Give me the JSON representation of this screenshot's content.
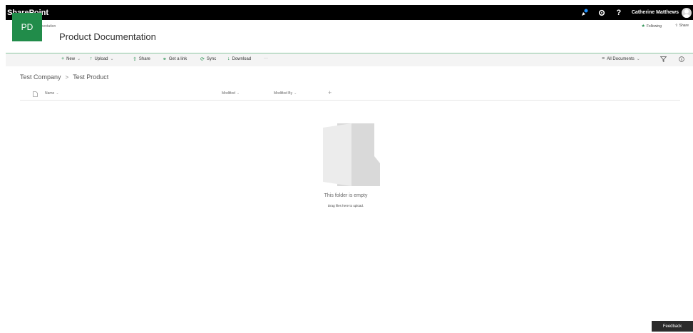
{
  "suitebar": {
    "brand": "SharePoint",
    "user_name": "Catherine Matthews",
    "help_label": "?"
  },
  "site": {
    "breadcrumb": "Product Documentation",
    "logo_initials": "PD",
    "title": "Product Documentation",
    "following_label": "Following",
    "share_label": "Share"
  },
  "commandbar": {
    "new_label": "New",
    "upload_label": "Upload",
    "share_label": "Share",
    "get_link_label": "Get a link",
    "sync_label": "Sync",
    "download_label": "Download",
    "more_label": "···",
    "view_label": "All Documents"
  },
  "breadcrumb": {
    "items": [
      "Test Company",
      "Test Product"
    ],
    "separator": ">"
  },
  "list": {
    "columns": {
      "name": "Name",
      "modified": "Modified",
      "modified_by": "Modified By"
    },
    "add_column": "+"
  },
  "empty_state": {
    "title": "This folder is empty",
    "subtitle": "Drag files here to upload."
  },
  "feedback_label": "Feedback",
  "colors": {
    "accent": "#218c4a",
    "suitebar": "#000000",
    "command_bg": "#f4f4f4"
  }
}
